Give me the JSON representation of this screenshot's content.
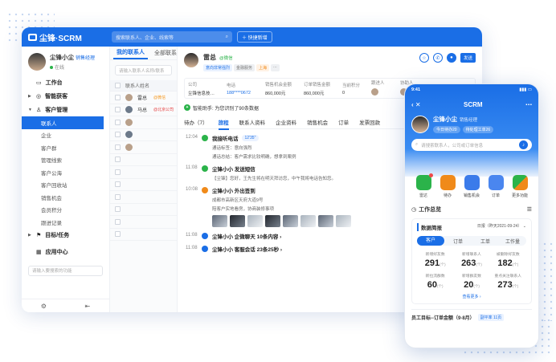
{
  "app": {
    "logo_text": "尘锋·SCRM"
  },
  "topbar": {
    "search_placeholder": "搜索联系人、企业、线索等",
    "quick_label": "＋ 快捷新增"
  },
  "sidebar": {
    "user": {
      "name": "尘锋小尘",
      "role": "销售经理",
      "status": "在线"
    },
    "items": [
      {
        "label": "工作台",
        "icon": "monitor-icon"
      },
      {
        "label": "智能获客",
        "icon": "target-icon"
      },
      {
        "label": "客户管理",
        "icon": "user-icon"
      }
    ],
    "sub_items": [
      "联系人",
      "企业",
      "客户群",
      "管理线索",
      "客户公海",
      "客户回收站",
      "销售机会",
      "会员积分",
      "跟进记录"
    ],
    "items_after": [
      {
        "label": "目标/任务"
      },
      {
        "label": "应用中心"
      }
    ],
    "search_placeholder": "请输入要搜索的功能"
  },
  "list": {
    "tabs": [
      "我的联系人",
      "全部联系"
    ],
    "search_placeholder": "请输入联系人名称/联系",
    "header": "联系人姓名",
    "rows": [
      {
        "name": "雷总",
        "tag": "@微信"
      },
      {
        "name": "马总",
        "tag": "@北京公司"
      }
    ]
  },
  "detail": {
    "name": "雷总",
    "wx": "@微信",
    "chips": [
      "意向非常强烈",
      "金融服务",
      "上海"
    ],
    "send_label": "发送",
    "info_keys": [
      "公司",
      "电话",
      "销售机会金额",
      "订单销售金额",
      "当前积分",
      "跟进人",
      "协助人"
    ],
    "info_vals": [
      "尘锋信息技…",
      "188****0672",
      "860,000元",
      "860,000元",
      "0",
      "",
      ""
    ],
    "assistant": "智能助手: 为您识别了90条数据",
    "tabs": [
      "待办（7）",
      "旅程",
      "联系人资料",
      "企业资料",
      "销售机会",
      "订单",
      "发票回款"
    ],
    "timeline": [
      {
        "time": "12:04",
        "title": "我接听电话",
        "pill": "12'35\"",
        "lines": [
          "通话标签：意向强烈",
          "通话总结：客户需求比较明确，想拿到案例"
        ]
      },
      {
        "time": "11:08",
        "title": "尘锋小小 发送短信",
        "lines": [
          "【尘锋】您好，王先生将在明天拜访您，中午我将电话告知您。"
        ]
      },
      {
        "time": "10:08",
        "title": "尘锋小小 外出签到",
        "lines": [
          "成都市高新区天府大道9号",
          "陪客户实地看房，协商装修事项"
        ]
      },
      {
        "time": "11:08",
        "title": "尘锋小小 企微聊天 10条内容 ›",
        "lines": []
      },
      {
        "time": "11:08",
        "title": "尘锋小小 客服会话 23条25秒 ›",
        "lines": []
      }
    ]
  },
  "phone": {
    "time": "9:41",
    "title": "SCRM",
    "user": {
      "name": "尘锋小尘",
      "role": "销售经理",
      "chip1": "今日待办20",
      "chip2": "待处理工单26"
    },
    "search_placeholder": "请搜索联系人，公司或订单信息",
    "apps": [
      {
        "label": "雷达",
        "color": "#2bb34a"
      },
      {
        "label": "待办",
        "color": "#f08a1a"
      },
      {
        "label": "销售机会",
        "color": "#3b7bea"
      },
      {
        "label": "订单",
        "color": "#4a86ef"
      },
      {
        "label": "更多功能",
        "color": "#2bb34a"
      }
    ],
    "section": "工作总览",
    "card_title": "数据简报",
    "date_range": "日报（昨天2021-09-24）",
    "seg": [
      "客户",
      "订单",
      "工单",
      "工作量"
    ],
    "stats": [
      {
        "k": "新增好友数",
        "v": "291"
      },
      {
        "k": "新增联系人",
        "v": "263"
      },
      {
        "k": "被删除好友数",
        "v": "182"
      },
      {
        "k": "新拉流群数",
        "v": "60"
      },
      {
        "k": "新增群友数",
        "v": "20"
      },
      {
        "k": "重点关注联系人",
        "v": "273"
      }
    ],
    "unit": "(个)",
    "more": "查看更多 ›",
    "goal": "员工目标--订单金额（9-8月）",
    "goal_tag": "副平率 11页"
  }
}
